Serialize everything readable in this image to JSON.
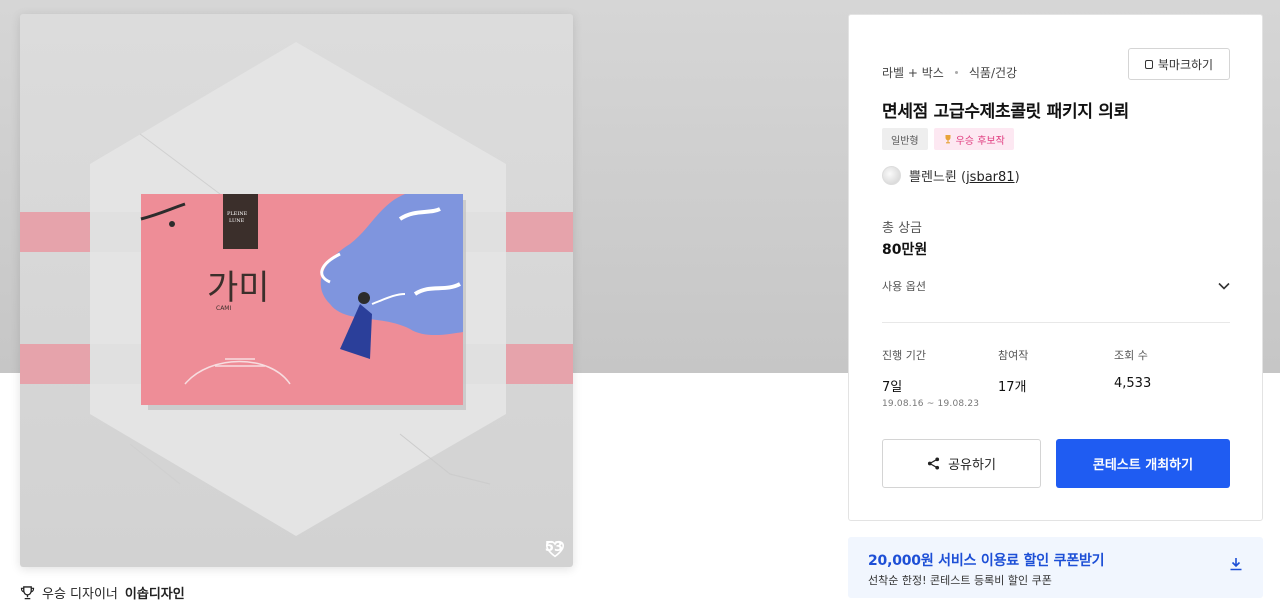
{
  "hero": {
    "image_alt": "가미 CAMI 고급수제초콜릿 패키지 디자인",
    "brand_text": "PLEINE LUNE",
    "package_title": "가미",
    "package_sub": "CAMI",
    "like_count": "53"
  },
  "winner": {
    "prefix": "우승 디자이너",
    "name": "이솝디자인"
  },
  "contest": {
    "category": "라벨 + 박스",
    "subcategory": "식품/건강",
    "bookmark_label": "북마크하기",
    "title": "면세점 고급수제초콜릿 패키지 의뢰",
    "tags": [
      "일반형",
      "우승 후보작"
    ],
    "designer_name": "쁠렌느륀",
    "designer_id": "jsbar81",
    "prize_label": "총 상금",
    "prize_value": "80만원",
    "option_label": "사용 옵션",
    "stats": [
      {
        "label": "진행 기간",
        "value": "7일",
        "sub": "19.08.16 ~ 19.08.23"
      },
      {
        "label": "참여작",
        "value": "17개"
      },
      {
        "label": "조회 수",
        "value": "4,533"
      }
    ],
    "share_label": "공유하기",
    "open_label": "콘테스트 개최하기"
  },
  "coupon": {
    "title": "20,000원 서비스 이용료 할인 쿠폰받기",
    "subtitle": "선착순 한정! 콘테스트 등록비 할인 쿠폰"
  },
  "colors": {
    "primary": "#1f5cf2",
    "coupon_text": "#1d4fd6",
    "package_pink": "#ee8d97",
    "illustration_blue": "#7f95de"
  },
  "icons": [
    "heart-icon",
    "trophy-icon",
    "bookmark-icon",
    "share-icon",
    "chevron-down-icon",
    "download-icon"
  ]
}
